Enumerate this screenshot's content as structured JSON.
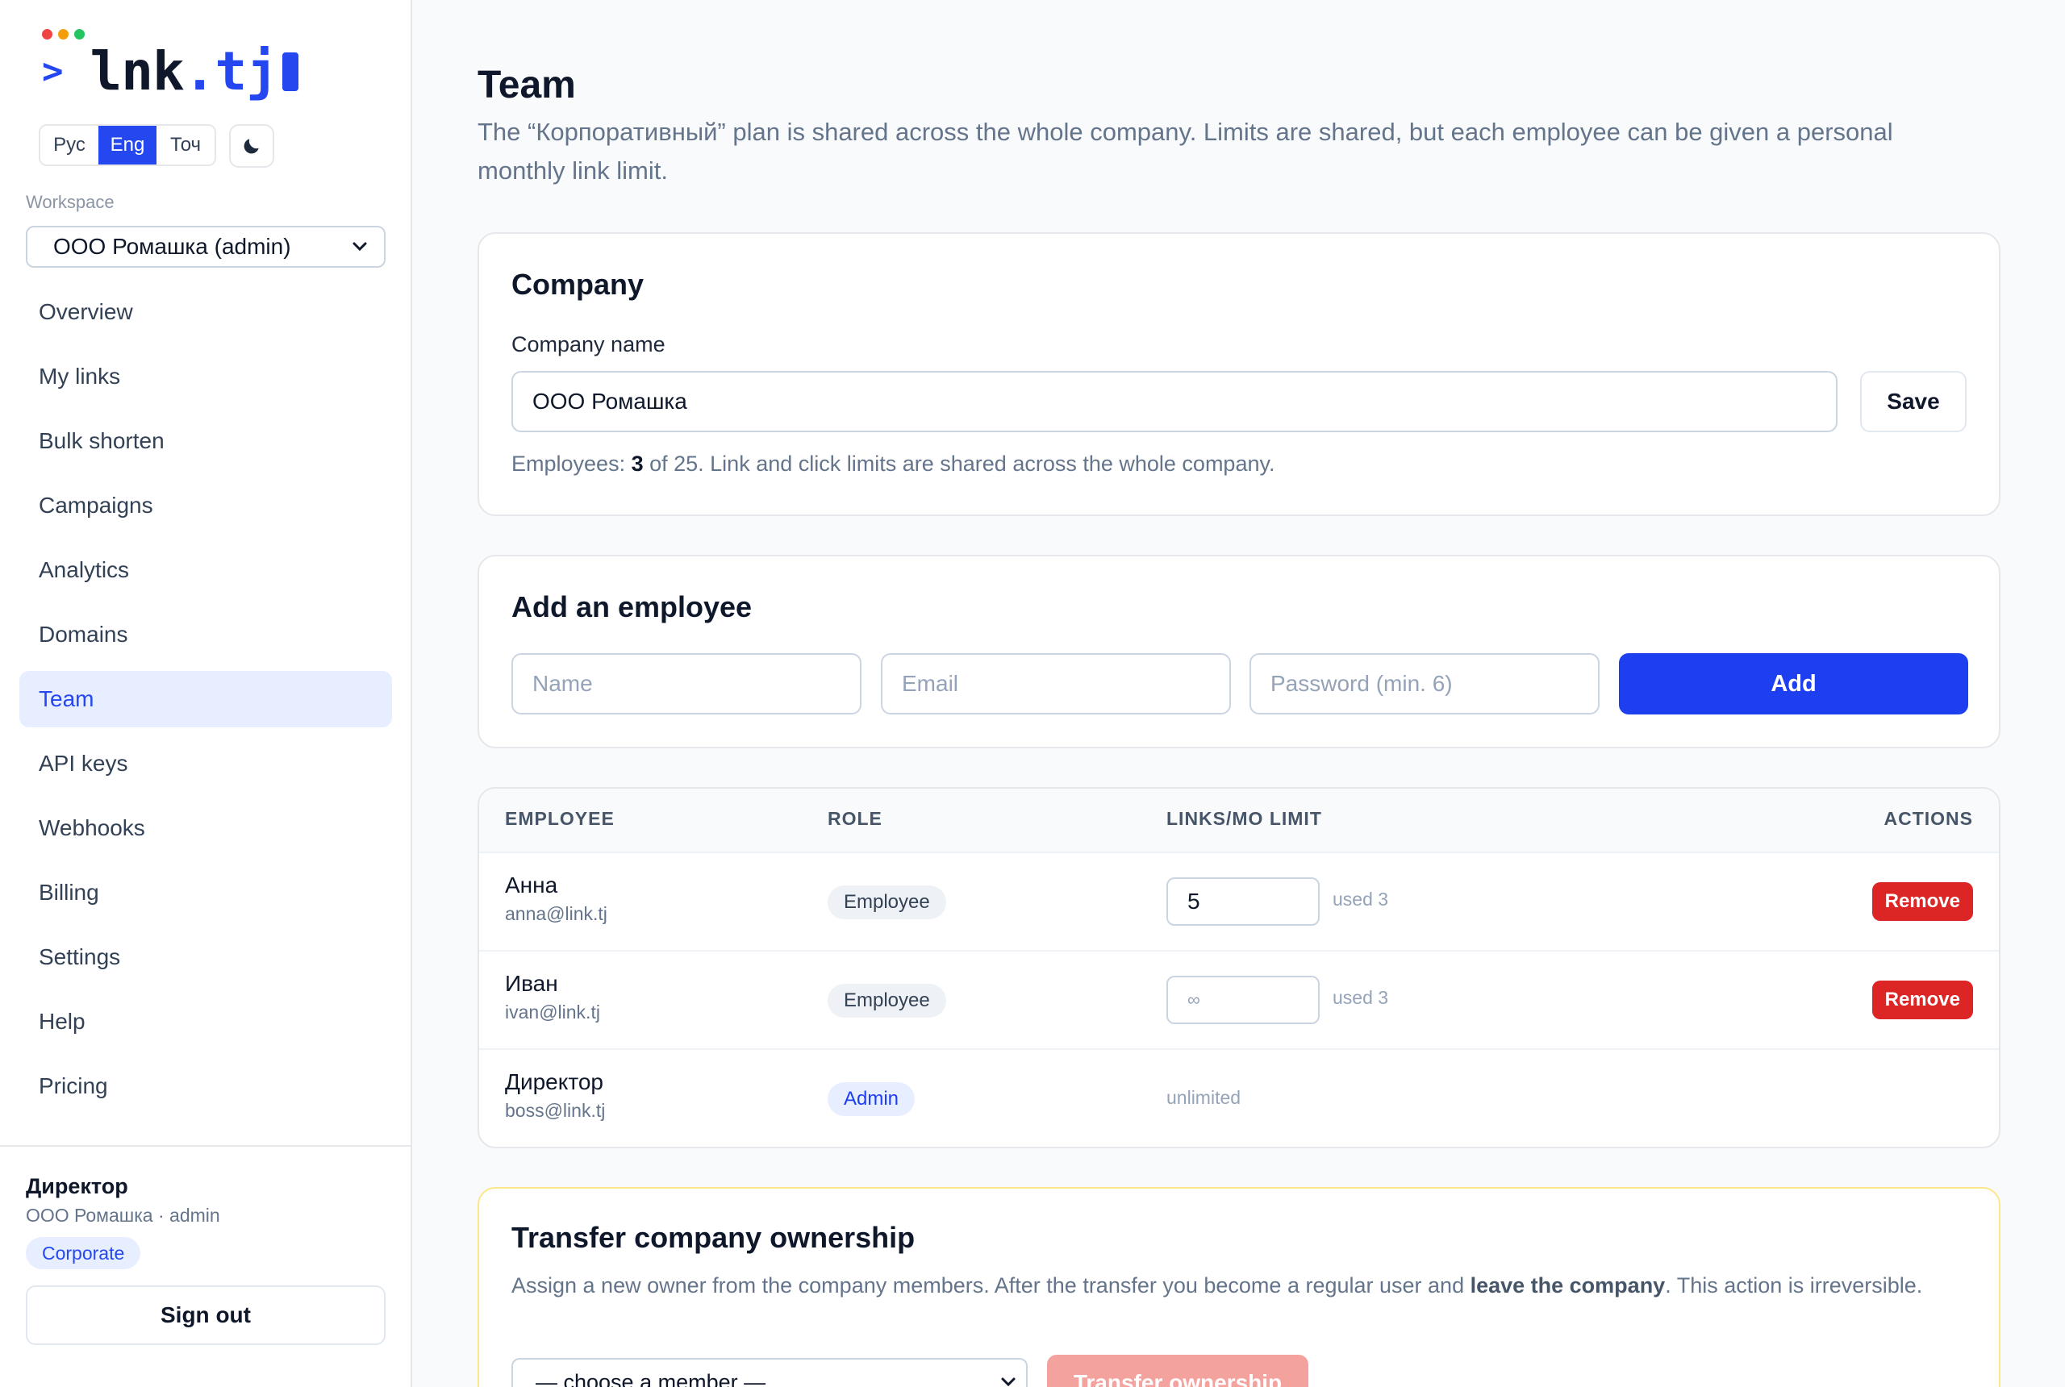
{
  "brand": {
    "logo_prompt": ">",
    "logo_base": "lnk",
    "logo_tld": ".tj",
    "dot_colors": [
      "#ef4444",
      "#f59e0b",
      "#22c55e"
    ],
    "accent": "#2547f0"
  },
  "lang": [
    "Рус",
    "Eng",
    "Точ"
  ],
  "lang_active": "Eng",
  "theme_icon": "moon-icon",
  "workspace": {
    "label": "Workspace",
    "value": "ООО Ромашка (admin)"
  },
  "nav": [
    {
      "label": "Overview"
    },
    {
      "label": "My links"
    },
    {
      "label": "Bulk shorten"
    },
    {
      "label": "Campaigns"
    },
    {
      "label": "Analytics"
    },
    {
      "label": "Domains"
    },
    {
      "label": "Team",
      "active": true
    },
    {
      "label": "API keys"
    },
    {
      "label": "Webhooks"
    },
    {
      "label": "Billing"
    },
    {
      "label": "Settings"
    },
    {
      "label": "Help"
    },
    {
      "label": "Pricing"
    }
  ],
  "user": {
    "name": "Директор",
    "meta": "ООО Ромашка · admin",
    "plan": "Corporate",
    "signout": "Sign out"
  },
  "page": {
    "title": "Team",
    "subtitle": "The “Корпоративный” plan is shared across the whole company. Limits are shared, but each employee can be given a personal monthly link limit."
  },
  "company": {
    "title": "Company",
    "name_label": "Company name",
    "name_value": "ООО Ромашка",
    "save": "Save",
    "note_prefix": "Employees: ",
    "note_count": "3",
    "note_suffix": " of 25. Link and click limits are shared across the whole company."
  },
  "add_employee": {
    "title": "Add an employee",
    "name_placeholder": "Name",
    "email_placeholder": "Email",
    "password_placeholder": "Password (min. 6)",
    "add": "Add"
  },
  "table": {
    "headers": {
      "employee": "EMPLOYEE",
      "role": "ROLE",
      "limit": "LINKS/MO LIMIT",
      "actions": "ACTIONS"
    },
    "rows": [
      {
        "name": "Анна",
        "email": "anna@link.tj",
        "role": "Employee",
        "limit": "5",
        "used": "used 3",
        "action": "Remove"
      },
      {
        "name": "Иван",
        "email": "ivan@link.tj",
        "role": "Employee",
        "limit_placeholder": "∞",
        "used": "used 3",
        "action": "Remove"
      },
      {
        "name": "Директор",
        "email": "boss@link.tj",
        "role": "Admin",
        "limit_text": "unlimited"
      }
    ]
  },
  "transfer": {
    "title": "Transfer company ownership",
    "desc_prefix": "Assign a new owner from the company members. After the transfer you become a regular user and ",
    "desc_bold": "leave the company",
    "desc_suffix": ". This action is irreversible.",
    "select_placeholder": "— choose a member —",
    "button": "Transfer ownership"
  }
}
